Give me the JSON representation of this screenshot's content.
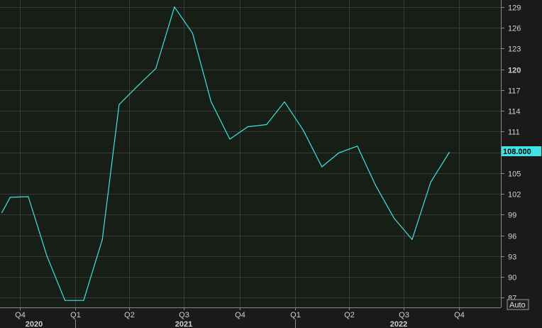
{
  "chart_data": {
    "type": "line",
    "title": "",
    "xlabel": "",
    "ylabel": "",
    "x_axis": {
      "quarter_labels": [
        "Q4",
        "Q1",
        "Q2",
        "Q3",
        "Q4",
        "Q1",
        "Q2",
        "Q3",
        "Q4"
      ],
      "year_labels": [
        "2020",
        "2021",
        "2022"
      ]
    },
    "y_axis": {
      "ticks": [
        87,
        90,
        93,
        96,
        99,
        102,
        105,
        108,
        111,
        114,
        117,
        120,
        123,
        126,
        129
      ],
      "bold_tick": 120,
      "range": [
        85.6,
        130.0
      ],
      "scale_button": "Auto"
    },
    "series": [
      {
        "color": "#3fe3e3",
        "x": [
          "2020-09-01",
          "2020-09-15",
          "2020-10-15",
          "2020-11-15",
          "2020-12-15",
          "2021-01-15",
          "2021-02-15",
          "2021-03-15",
          "2021-04-15",
          "2021-05-15",
          "2021-06-15",
          "2021-07-15",
          "2021-08-15",
          "2021-09-15",
          "2021-10-15",
          "2021-11-15",
          "2021-12-15",
          "2022-01-15",
          "2022-02-15",
          "2022-03-15",
          "2022-04-15",
          "2022-05-15",
          "2022-06-15",
          "2022-07-15",
          "2022-08-15",
          "2022-09-15"
        ],
        "values": [
          99.3,
          101.5,
          101.6,
          93.0,
          86.6,
          86.6,
          95.4,
          114.9,
          117.6,
          120.1,
          129.0,
          125.2,
          115.3,
          109.9,
          111.7,
          112.0,
          115.3,
          111.2,
          105.9,
          107.9,
          108.9,
          103.3,
          98.5,
          95.4,
          103.7,
          108.0
        ]
      }
    ],
    "last_value_label": "108.000",
    "colors": {
      "background": "#1a1a1a",
      "plot_background": "#161e16",
      "grid": "#3a3a3a",
      "axis_text": "#d0d0d0",
      "line": "#3fe3e3",
      "last_value_tag": "#3fe3e3"
    },
    "grid": true
  }
}
